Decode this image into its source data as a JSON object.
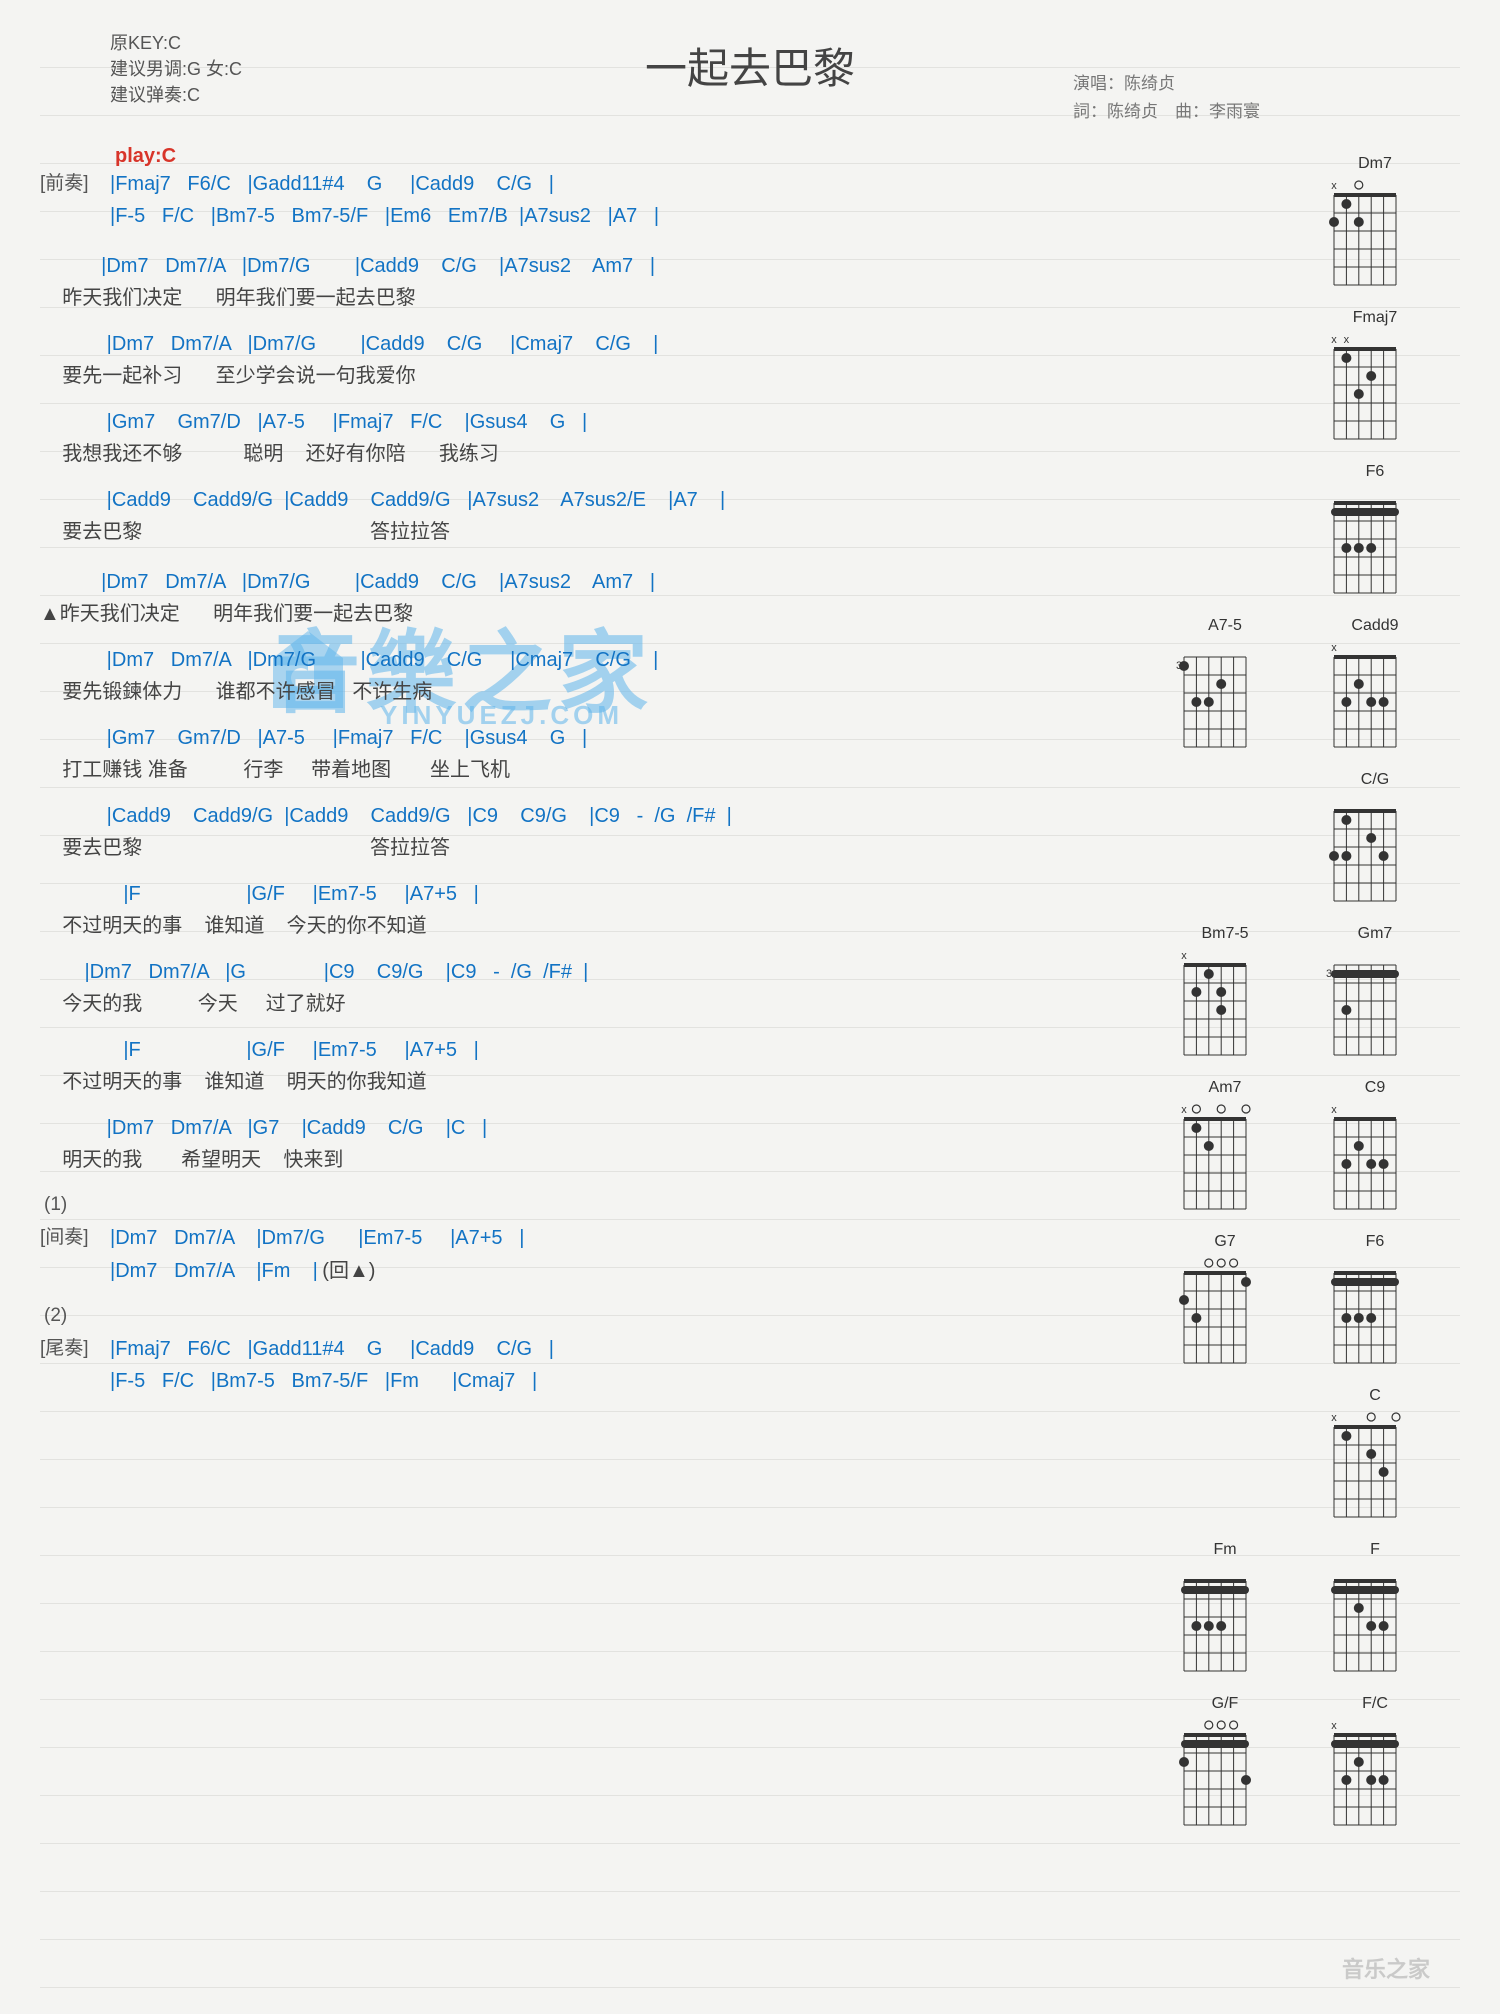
{
  "meta": {
    "title": "一起去巴黎",
    "original_key": "原KEY:C",
    "suggest_gender": "建议男调:G 女:C",
    "suggest_play": "建议弹奏:C",
    "play_key": "play:C",
    "singer_label": "演唱：",
    "singer": "陈绮贞",
    "lyricist_label": "詞：",
    "lyricist": "陈绮贞",
    "composer_label": "曲：",
    "composer": "李雨寰"
  },
  "sections": {
    "intro_label": "[前奏]",
    "intro_l1": "|Fmaj7   F6/C   |Gadd11#4    G     |Cadd9    C/G   |",
    "intro_l2": "|F-5   F/C   |Bm7-5   Bm7-5/F   |Em6   Em7/B  |A7sus2   |A7   |",
    "v1_c1": "           |Dm7   Dm7/A   |Dm7/G        |Cadd9    C/G    |A7sus2    Am7   |",
    "v1_l1": "    昨天我们决定      明年我们要一起去巴黎",
    "v1_c2": "            |Dm7   Dm7/A   |Dm7/G        |Cadd9    C/G     |Cmaj7    C/G    |",
    "v1_l2": "    要先一起补习      至少学会说一句我爱你",
    "v1_c3": "            |Gm7    Gm7/D   |A7-5     |Fmaj7   F/C    |Gsus4    G   |",
    "v1_l3": "    我想我还不够           聪明    还好有你陪      我练习",
    "v1_c4": "            |Cadd9    Cadd9/G  |Cadd9    Cadd9/G   |A7sus2    A7sus2/E    |A7    |",
    "v1_l4": "    要去巴黎                                         答拉拉答",
    "v2_c1": "           |Dm7   Dm7/A   |Dm7/G        |Cadd9    C/G    |A7sus2    Am7   |",
    "v2_l1": "▲昨天我们决定      明年我们要一起去巴黎",
    "v2_c2": "            |Dm7   Dm7/A   |Dm7/G        |Cadd9    C/G     |Cmaj7    C/G    |",
    "v2_l2": "    要先锻鍊体力      谁都不许感冒   不许生病",
    "v2_c3": "            |Gm7    Gm7/D   |A7-5     |Fmaj7   F/C    |Gsus4    G   |",
    "v2_l3": "    打工赚钱 准备          行李     带着地图       坐上飞机",
    "v2_c4": "            |Cadd9    Cadd9/G  |Cadd9    Cadd9/G   |C9    C9/G    |C9   -  /G  /F#  |",
    "v2_l4": "    要去巴黎                                         答拉拉答",
    "b_c1": "               |F                   |G/F     |Em7-5     |A7+5   |",
    "b_l1": "    不过明天的事    谁知道    今天的你不知道",
    "b_c2": "        |Dm7   Dm7/A   |G              |C9    C9/G    |C9   -  /G  /F#  |",
    "b_l2": "    今天的我          今天     过了就好",
    "b_c3": "               |F                   |G/F     |Em7-5     |A7+5   |",
    "b_l3": "    不过明天的事    谁知道    明天的你我知道",
    "b_c4": "            |Dm7   Dm7/A   |G7    |Cadd9    C/G    |C   |",
    "b_l4": "    明天的我       希望明天    快来到",
    "num1": "(1)",
    "inter_label": "[间奏]",
    "inter_l1": "|Dm7   Dm7/A    |Dm7/G      |Em7-5     |A7+5   |",
    "inter_l2_a": "|Dm7   Dm7/A    |Fm    |",
    "inter_l2_b": "(回▲)",
    "num2": "(2)",
    "outro_label": "[尾奏]",
    "outro_l1": "|Fmaj7   F6/C   |Gadd11#4    G     |Cadd9    C/G   |",
    "outro_l2": "|F-5   F/C   |Bm7-5   Bm7-5/F   |Fm      |Cmaj7   |"
  },
  "chord_data": {
    "diagrams": [
      {
        "row": 1,
        "names": [
          "Dm7"
        ]
      },
      {
        "row": 2,
        "names": [
          "Fmaj7"
        ]
      },
      {
        "row": 3,
        "names": [
          "F6"
        ]
      },
      {
        "row": 4,
        "names": [
          "A7-5",
          "Cadd9"
        ]
      },
      {
        "row": 5,
        "names": [
          "C/G"
        ]
      },
      {
        "row": 6,
        "names": [
          "Bm7-5",
          "Gm7"
        ]
      },
      {
        "row": 7,
        "names": [
          "Am7",
          "C9"
        ]
      },
      {
        "row": 8,
        "names": [
          "G7",
          "F6"
        ]
      },
      {
        "row": 9,
        "names": [
          "C"
        ]
      },
      {
        "row": 10,
        "names": [
          "Fm",
          "F"
        ]
      },
      {
        "row": 11,
        "names": [
          "G/F",
          "F/C"
        ]
      }
    ],
    "Dm7": {
      "top": [
        "x",
        "",
        "o",
        "",
        "",
        ""
      ],
      "dots": [
        [
          1,
          2
        ],
        [
          2,
          1
        ],
        [
          2,
          3
        ]
      ]
    },
    "Fmaj7": {
      "top": [
        "x",
        "x",
        "",
        "",
        "",
        ""
      ],
      "dots": [
        [
          1,
          2
        ],
        [
          2,
          4
        ],
        [
          3,
          3
        ]
      ]
    },
    "F6_a": {
      "top": [
        "",
        "",
        "",
        "",
        "",
        ""
      ],
      "barre": 1,
      "dots": [
        [
          3,
          2
        ],
        [
          3,
          3
        ],
        [
          3,
          4
        ]
      ]
    },
    "A7-5": {
      "top": [
        "",
        "",
        "",
        "",
        "",
        ""
      ],
      "fret": "3",
      "dots": [
        [
          1,
          1
        ],
        [
          2,
          4
        ],
        [
          3,
          2
        ],
        [
          3,
          3
        ]
      ]
    },
    "Cadd9": {
      "top": [
        "x",
        "",
        "",
        "",
        "",
        ""
      ],
      "dots": [
        [
          2,
          3
        ],
        [
          3,
          2
        ],
        [
          3,
          4
        ],
        [
          3,
          5
        ]
      ]
    },
    "C/G": {
      "top": [
        "",
        "",
        "",
        "",
        "",
        ""
      ],
      "dots": [
        [
          1,
          2
        ],
        [
          2,
          4
        ],
        [
          3,
          1
        ],
        [
          3,
          2
        ],
        [
          3,
          5
        ]
      ]
    },
    "Bm7-5": {
      "top": [
        "x",
        "",
        "",
        "",
        "",
        ""
      ],
      "dots": [
        [
          1,
          3
        ],
        [
          2,
          2
        ],
        [
          3,
          4
        ],
        [
          2,
          4
        ]
      ]
    },
    "Gm7": {
      "top": [
        "",
        "",
        "",
        "",
        "",
        ""
      ],
      "fret": "3",
      "barre": 1,
      "dots": [
        [
          3,
          2
        ]
      ]
    },
    "Am7": {
      "top": [
        "x",
        "o",
        "",
        "o",
        "",
        "o"
      ],
      "dots": [
        [
          1,
          2
        ],
        [
          2,
          3
        ]
      ]
    },
    "C9": {
      "top": [
        "x",
        "",
        "",
        "",
        "",
        ""
      ],
      "dots": [
        [
          2,
          3
        ],
        [
          3,
          2
        ],
        [
          3,
          4
        ],
        [
          3,
          5
        ]
      ]
    },
    "G7": {
      "top": [
        "",
        "",
        "o",
        "o",
        "o",
        ""
      ],
      "dots": [
        [
          1,
          6
        ],
        [
          2,
          1
        ],
        [
          3,
          2
        ]
      ]
    },
    "F6_b": {
      "top": [
        "",
        "",
        "",
        "",
        "",
        ""
      ],
      "barre": 1,
      "dots": [
        [
          3,
          2
        ],
        [
          3,
          3
        ],
        [
          3,
          4
        ]
      ]
    },
    "C": {
      "top": [
        "x",
        "",
        "",
        "o",
        "",
        "o"
      ],
      "dots": [
        [
          1,
          2
        ],
        [
          2,
          4
        ],
        [
          3,
          5
        ]
      ]
    },
    "Fm": {
      "top": [
        "",
        "",
        "",
        "",
        "",
        ""
      ],
      "barre": 1,
      "dots": [
        [
          3,
          2
        ],
        [
          3,
          3
        ],
        [
          3,
          4
        ]
      ]
    },
    "F": {
      "top": [
        "",
        "",
        "",
        "",
        "",
        ""
      ],
      "barre": 1,
      "dots": [
        [
          2,
          3
        ],
        [
          3,
          4
        ],
        [
          3,
          5
        ]
      ]
    },
    "G/F": {
      "top": [
        "",
        "",
        "o",
        "o",
        "o",
        ""
      ],
      "barre": 1,
      "dots": [
        [
          2,
          1
        ],
        [
          3,
          6
        ]
      ]
    },
    "F/C": {
      "top": [
        "x",
        "",
        "",
        "",
        "",
        ""
      ],
      "barre": 1,
      "dots": [
        [
          2,
          3
        ],
        [
          3,
          4
        ],
        [
          3,
          5
        ],
        [
          3,
          2
        ]
      ]
    }
  },
  "watermark": {
    "main": "音樂之家",
    "sub": "YINYUEZJ.COM",
    "corner": "音乐之家"
  }
}
